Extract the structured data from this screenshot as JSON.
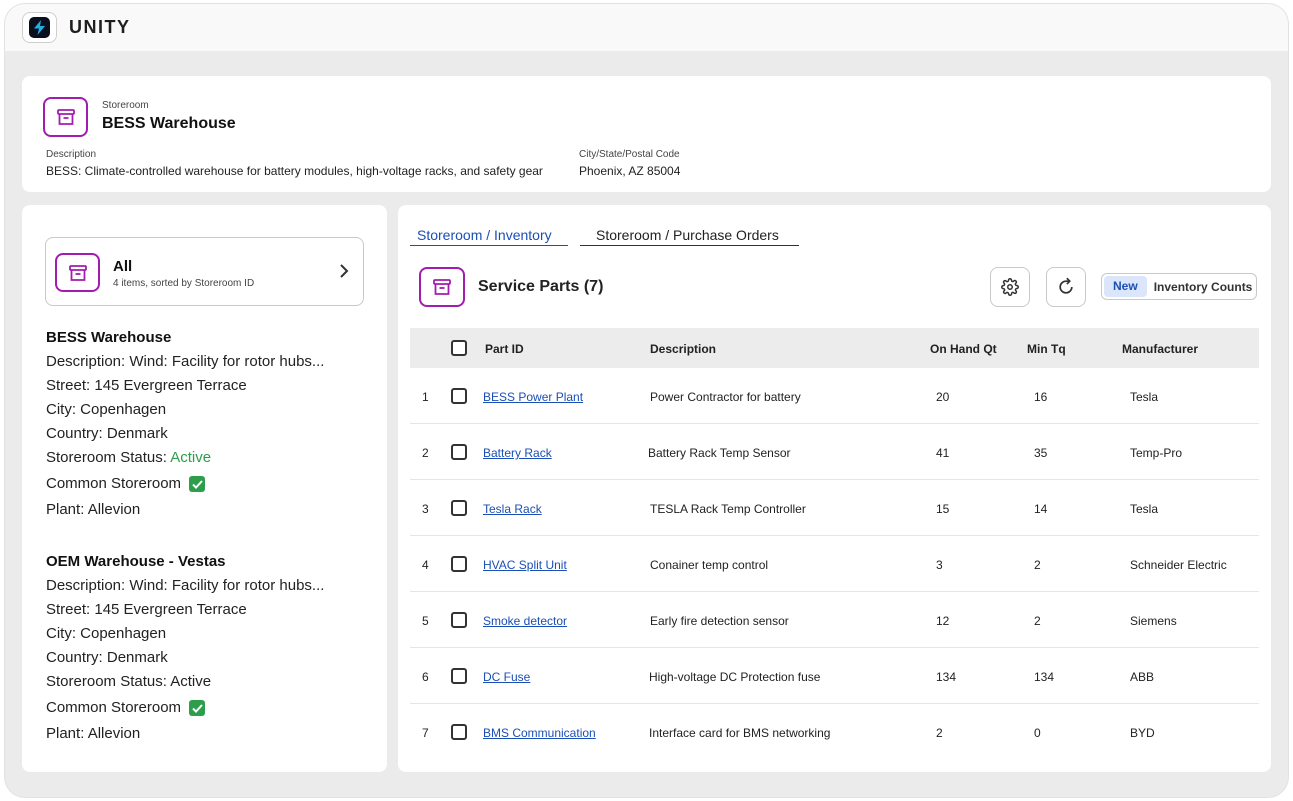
{
  "app": {
    "brand": "UNITY"
  },
  "header": {
    "label": "Storeroom",
    "title": "BESS Warehouse",
    "description_label": "Description",
    "description": "BESS: Climate-controlled warehouse for battery modules, high-voltage racks, and safety gear",
    "city_label": "City/State/Postal Code",
    "city": "Phoenix, AZ 85004"
  },
  "sidebar": {
    "all": {
      "title": "All",
      "subtitle": "4 items, sorted by Storeroom ID"
    },
    "storerooms": [
      {
        "name": "BESS Warehouse",
        "description": "Description: Wind: Facility for rotor hubs...",
        "street": "Street: 145 Evergreen Terrace",
        "city": "City: Copenhagen",
        "country": "Country: Denmark",
        "status_label": "Storeroom Status: ",
        "status": "Active",
        "common": "Common Storeroom",
        "plant": "Plant: Allevion"
      },
      {
        "name": "OEM Warehouse - Vestas",
        "description": "Description: Wind: Facility for rotor hubs...",
        "street": "Street: 145 Evergreen Terrace",
        "city": "City: Copenhagen",
        "country": "Country: Denmark",
        "status_label": "Storeroom Status: ",
        "status": "Active",
        "common": "Common Storeroom",
        "plant": "Plant: Allevion"
      }
    ]
  },
  "tabs": [
    {
      "label": "Storeroom / Inventory",
      "active": true
    },
    {
      "label": "Storeroom / Purchase Orders",
      "active": false
    }
  ],
  "parts": {
    "title": "Service Parts (7)",
    "toggle_new": "New",
    "toggle_inventory": "Inventory Counts",
    "columns": {
      "part_id": "Part ID",
      "description": "Description",
      "on_hand": "On Hand Qt",
      "min": "Min Tq",
      "manufacturer": "Manufacturer"
    },
    "rows": [
      {
        "num": "1",
        "part_id": "BESS Power Plant",
        "description": "Power Contractor for battery",
        "on_hand": "20",
        "min": "16",
        "manufacturer": "Tesla"
      },
      {
        "num": "2",
        "part_id": "Battery Rack",
        "description": "Battery Rack Temp Sensor",
        "on_hand": "41",
        "min": "35",
        "manufacturer": "Temp-Pro"
      },
      {
        "num": "3",
        "part_id": "Tesla Rack",
        "description": "TESLA Rack Temp Controller",
        "on_hand": "15",
        "min": "14",
        "manufacturer": "Tesla"
      },
      {
        "num": "4",
        "part_id": "HVAC Split Unit",
        "description": "Conainer temp control",
        "on_hand": "3",
        "min": "2",
        "manufacturer": "Schneider Electric"
      },
      {
        "num": "5",
        "part_id": "Smoke detector",
        "description": "Early fire detection sensor",
        "on_hand": "12",
        "min": "2",
        "manufacturer": "Siemens"
      },
      {
        "num": "6",
        "part_id": "DC Fuse",
        "description": "High-voltage DC Protection fuse",
        "on_hand": "134",
        "min": "134",
        "manufacturer": "ABB"
      },
      {
        "num": "7",
        "part_id": "BMS Communication",
        "description": "Interface card for BMS networking",
        "on_hand": "2",
        "min": "0",
        "manufacturer": "BYD"
      }
    ]
  }
}
